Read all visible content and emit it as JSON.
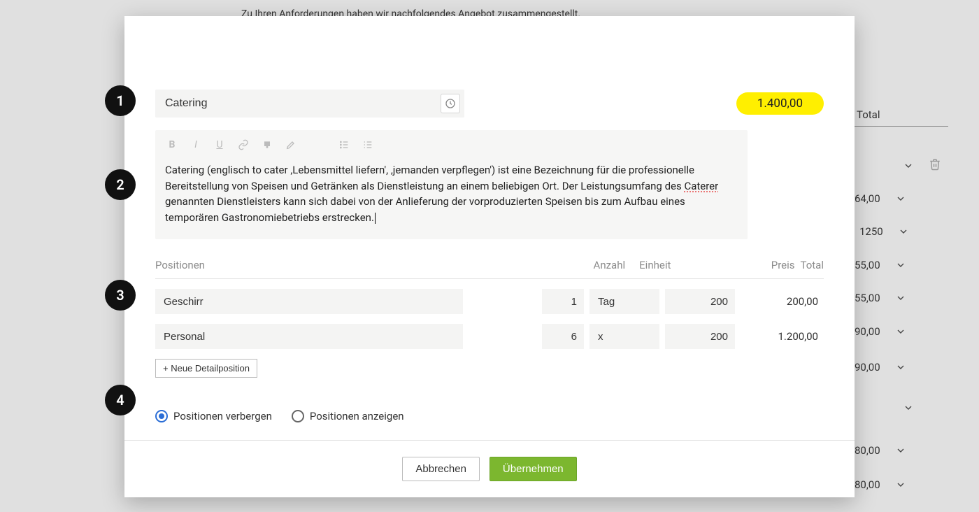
{
  "background": {
    "line1": "Zu Ihren Anforderungen haben wir nachfolgendes Angebot zusammengestellt.",
    "total_label": "Total",
    "amounts": [
      "64,00",
      "1250",
      "55,00",
      "55,00",
      "90,00",
      "90,00",
      "80,00",
      "80,00"
    ]
  },
  "badges": {
    "b1": "1",
    "b2": "2",
    "b3": "3",
    "b4": "4"
  },
  "modal": {
    "title_value": "Catering",
    "grand_total": "1.400,00",
    "description_plain": "Catering (englisch to cater ‚Lebensmittel liefern', ‚jemanden verpflegen') ist eine Bezeichnung für die professionelle Bereitstellung von Speisen und Getränken als Dienstleistung an einem beliebigen Ort. Der Leistungsumfang des Caterer genannten Dienstleisters kann sich dabei von der Anlieferung der vorproduzierten Speisen bis zum Aufbau eines temporären Gastronomiebetriebs erstrecken.",
    "desc_part1": "Catering (englisch to cater ‚Lebensmittel liefern', ‚jemanden verpflegen') ist eine Bezeichnung für die professionelle Bereitstellung von Speisen und Getränken als Dienstleistung an einem beliebigen Ort. Der Leistungsumfang des ",
    "desc_spell": "Caterer",
    "desc_part2": " genannten Dienstleisters kann sich dabei von der Anlieferung der vorproduzierten Speisen bis zum Aufbau eines temporären Gastronomiebetriebs erstrecken.",
    "columns": {
      "positions": "Positionen",
      "qty": "Anzahl",
      "unit": "Einheit",
      "price": "Preis",
      "total": "Total"
    },
    "rows": [
      {
        "name": "Geschirr",
        "qty": "1",
        "unit": "Tag",
        "price": "200",
        "total": "200,00"
      },
      {
        "name": "Personal",
        "qty": "6",
        "unit": "x",
        "price": "200",
        "total": "1.200,00"
      }
    ],
    "add_label": "+ Neue Detailposition",
    "radio_hide": "Positionen verbergen",
    "radio_show": "Positionen anzeigen",
    "cancel": "Abbrechen",
    "submit": "Übernehmen"
  }
}
